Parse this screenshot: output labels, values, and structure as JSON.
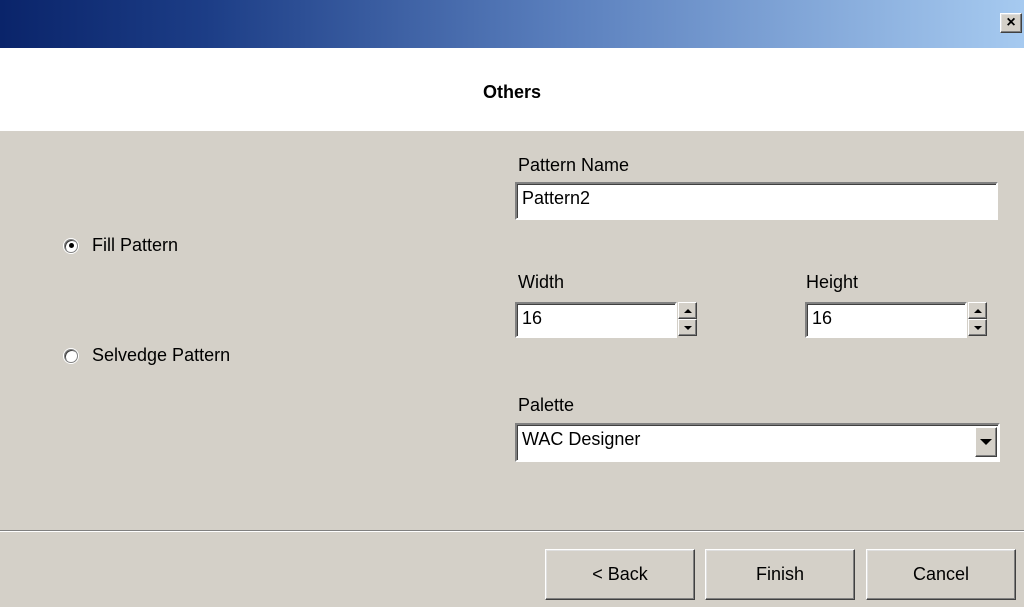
{
  "window": {
    "close_label": "×"
  },
  "header": {
    "title": "Others"
  },
  "options": {
    "fill_pattern": {
      "label": "Fill Pattern",
      "selected": true
    },
    "selvedge_pattern": {
      "label": "Selvedge Pattern",
      "selected": false
    }
  },
  "fields": {
    "pattern_name": {
      "label": "Pattern Name",
      "value": "Pattern2"
    },
    "width": {
      "label": "Width",
      "value": "16"
    },
    "height": {
      "label": "Height",
      "value": "16"
    },
    "palette": {
      "label": "Palette",
      "value": "WAC Designer"
    }
  },
  "buttons": {
    "back": "< Back",
    "finish": "Finish",
    "cancel": "Cancel"
  }
}
